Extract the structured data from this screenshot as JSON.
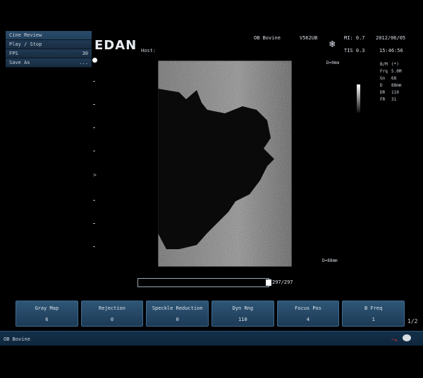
{
  "menu": {
    "items": [
      {
        "label": "Cine Review",
        "value": ""
      },
      {
        "label": "Play / Stop",
        "value": ""
      },
      {
        "label": "FPS",
        "value": "30"
      },
      {
        "label": "Save As",
        "value": "..."
      }
    ]
  },
  "header": {
    "logo": "EDAN",
    "host_label": "Host:",
    "exam": "OB Bovine",
    "probe": "V562UB",
    "mi": "MI: 0.7",
    "tis": "TIS 0.3",
    "date": "2012/06/05",
    "time": "15:46:56",
    "freeze_icon": "snowflake-icon"
  },
  "params": [
    {
      "key": "B/M",
      "value": "(*)"
    },
    {
      "key": "Frq",
      "value": "5.0M"
    },
    {
      "key": "Gn",
      "value": "68"
    },
    {
      "key": "D",
      "value": "88mm"
    },
    {
      "key": "DR",
      "value": "110"
    },
    {
      "key": "FR",
      "value": "31"
    }
  ],
  "depth": {
    "top": "D=0mm",
    "bottom": "D=88mm"
  },
  "cine": {
    "count": "297/297",
    "progress": 1.0
  },
  "softkeys": [
    {
      "label": "Gray Map",
      "value": "6"
    },
    {
      "label": "Rejection",
      "value": "0"
    },
    {
      "label": "Speckle Reduction",
      "value": "0"
    },
    {
      "label": "Dyn Rng",
      "value": "110"
    },
    {
      "label": "Focus Pos",
      "value": "4"
    },
    {
      "label": "B Freq",
      "value": "1"
    }
  ],
  "page_indicator": "1/2",
  "status": {
    "text": "OB Bovine"
  },
  "colors": {
    "panel": "#1c3a56",
    "accent": "#e3342f"
  }
}
